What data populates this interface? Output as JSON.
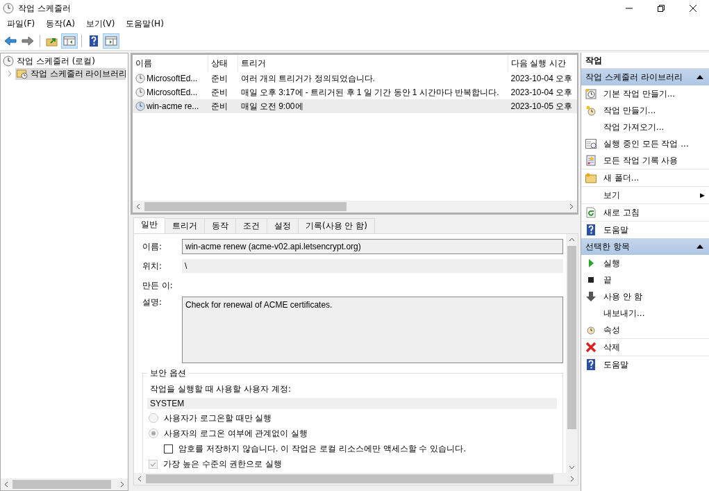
{
  "window": {
    "title": "작업 스케줄러"
  },
  "menu": [
    "파일(F)",
    "동작(A)",
    "보기(V)",
    "도움말(H)"
  ],
  "tree": {
    "root": "작업 스케줄러 (로컬)",
    "children": [
      {
        "label": "작업 스케줄러 라이브러리",
        "selected": true
      }
    ]
  },
  "table": {
    "columns": [
      "이름",
      "상태",
      "트리거",
      "다음 실행 시간"
    ],
    "rows": [
      {
        "name": "MicrosoftEd...",
        "status": "준비",
        "trigger": "여러 개의 트리거가 정의되었습니다.",
        "next_run": "2023-10-04 오후",
        "selected": false
      },
      {
        "name": "MicrosoftEd...",
        "status": "준비",
        "trigger": "매일 오후 3:17에 - 트리거된 후 1 일 기간 동안 1 시간마다 반복합니다.",
        "next_run": "2023-10-04 오후",
        "selected": false
      },
      {
        "name": "win-acme re...",
        "status": "준비",
        "trigger": "매일 오전 9:00에",
        "next_run": "2023-10-05 오후",
        "selected": true
      }
    ]
  },
  "tabs": [
    {
      "label": "일반",
      "selected": true
    },
    {
      "label": "트리거",
      "selected": false
    },
    {
      "label": "동작",
      "selected": false
    },
    {
      "label": "조건",
      "selected": false
    },
    {
      "label": "설정",
      "selected": false
    },
    {
      "label": "기록(사용 안 함)",
      "selected": false
    }
  ],
  "general": {
    "name_label": "이름:",
    "name": "win-acme renew (acme-v02.api.letsencrypt.org)",
    "location_label": "위치:",
    "location": "\\",
    "author_label": "만든 이:",
    "description_label": "설명:",
    "description": "Check for renewal of ACME certificates.",
    "security": {
      "title": "보안 옵션",
      "account_label": "작업을 실행할 때 사용할 사용자 계정:",
      "account": "SYSTEM",
      "options": [
        {
          "kind": "radio",
          "label": "사용자가 로그온할 때만 실행",
          "selected": false,
          "disabled": true
        },
        {
          "kind": "radio",
          "label": "사용자의 로그온 여부에 관계없이 실행",
          "selected": true,
          "disabled": true,
          "children": [
            {
              "kind": "checkbox",
              "label": "암호를 저장하지 않습니다. 이 작업은 로컬 리소스에만 액세스할 수 있습니다.",
              "checked": false,
              "disabled": false
            }
          ]
        },
        {
          "kind": "checkbox",
          "label": "가장 높은 수준의 권한으로 실행",
          "checked": true,
          "disabled": true
        }
      ]
    }
  },
  "actions": {
    "title": "작업",
    "sections": [
      {
        "title": "작업 스케줄러 라이브러리",
        "groups": [
          {
            "items": [
              {
                "label": "기본 작업 만들기..."
              },
              {
                "label": "작업 만들기..."
              },
              {
                "label": "작업 가져오기..."
              },
              {
                "label": "실행 중인 모든 작업 ..."
              },
              {
                "label": "모든 작업 기록 사용"
              }
            ]
          },
          {
            "items": [
              {
                "label": "새 폴더..."
              }
            ]
          },
          {
            "items": [
              {
                "label": "보기",
                "arrow": "▶"
              }
            ]
          },
          {
            "items": [
              {
                "label": "새로 고침"
              }
            ]
          },
          {
            "items": [
              {
                "label": "도움말"
              }
            ]
          }
        ]
      },
      {
        "title": "선택한 항목",
        "groups": [
          {
            "items": [
              {
                "label": "실행"
              },
              {
                "label": "끝"
              },
              {
                "label": "사용 안 함"
              },
              {
                "label": "내보내기..."
              },
              {
                "label": "속성"
              }
            ]
          },
          {
            "items": [
              {
                "label": "삭제"
              }
            ]
          },
          {
            "items": [
              {
                "label": "도움말"
              }
            ]
          }
        ]
      }
    ]
  }
}
